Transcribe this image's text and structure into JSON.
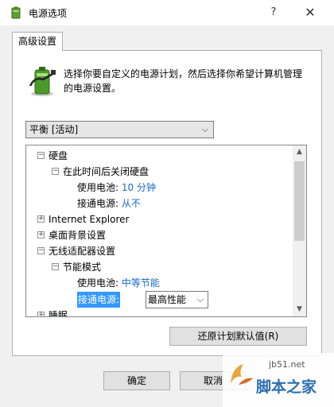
{
  "window": {
    "title": "电源选项",
    "help_label": "?",
    "close_label": "✕"
  },
  "tab": {
    "label": "高级设置"
  },
  "description": "选择你要自定义的电源计划，然后选择你希望计算机管理的电源设置。",
  "plan_select": {
    "value": "平衡 [活动]"
  },
  "tree": {
    "hard_disk": {
      "label": "硬盘",
      "expander": "⊟",
      "sub": {
        "label": "在此时间后关闭硬盘",
        "expander": "⊟",
        "battery_label": "使用电池:",
        "battery_value": "10 分钟",
        "plugged_label": "接通电源:",
        "plugged_value": "从不"
      }
    },
    "ie": {
      "label": "Internet Explorer",
      "expander": "⊞"
    },
    "desktop_bg": {
      "label": "桌面背景设置",
      "expander": "⊞"
    },
    "wireless": {
      "label": "无线适配器设置",
      "expander": "⊟",
      "sub": {
        "label": "节能模式",
        "expander": "⊟",
        "battery_label": "使用电池:",
        "battery_value": "中等节能",
        "plugged_label": "接通电源:",
        "plugged_value": "最高性能"
      }
    },
    "sleep": {
      "label": "睡眠",
      "expander": "⊞"
    }
  },
  "buttons": {
    "restore": "还原计划默认值(R)",
    "ok": "确定",
    "cancel": "取消"
  },
  "watermark": {
    "url": "jb51.net",
    "text": "脚本之家"
  },
  "colors": {
    "value_blue": "#1b6ac9",
    "selection": "#3399ff",
    "dialog_bg": "#f0f0f0"
  }
}
